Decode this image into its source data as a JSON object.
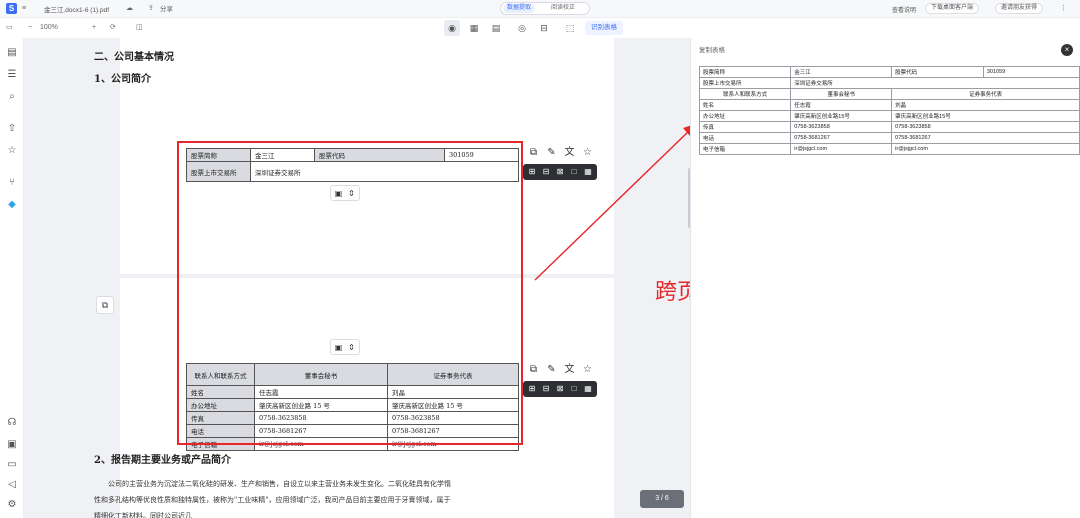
{
  "app": {
    "logo_glyph": "S"
  },
  "topbar": {
    "doc_name": "金三江.docx1-6 (1).pdf",
    "share_label": "分享",
    "modes": {
      "active": "数据提取",
      "inactive": "阅读校正"
    },
    "right": {
      "download_label": "下载桌面客户端",
      "invite_label": "邀请朋友获得"
    },
    "right_small": "查看说明"
  },
  "toolbar": {
    "zoom": "100%",
    "recognize_label": "识别表格"
  },
  "document": {
    "section_title": "二、公司基本情况",
    "sub_title": "1、公司简介",
    "stock_table": {
      "row1": [
        "股票简称",
        "金三江",
        "股票代码",
        "301059"
      ],
      "row2": [
        "股票上市交易所",
        "深圳证券交易所"
      ]
    },
    "contact_table": {
      "header": [
        "联系人和联系方式",
        "董事会秘书",
        "证券事务代表"
      ],
      "rows": [
        [
          "姓名",
          "任志霞",
          "刘晶"
        ],
        [
          "办公地址",
          "肇庆高新区创业路 15 号",
          "肇庆高新区创业路 15 号"
        ],
        [
          "传真",
          "0758-3623858",
          "0758-3623858"
        ],
        [
          "电话",
          "0758-3681267",
          "0758-3681267"
        ],
        [
          "电子信箱",
          "ir@jsjgcl.com",
          "ir@jsjgcl.com"
        ]
      ]
    },
    "section2_title": "2、报告期主要业务或产品简介",
    "paragraph": "公司的主营业务为沉淀法二氧化硅的研发、生产和销售，自设立以来主营业务未发生变化。二氧化硅具有化学惰性和多孔结构等优良性质和独特属性，被称为\"工业味精\"，应用领域广泛，我司产品目前主要应用于牙膏领域，属于精细化工新材料。同时公司近几",
    "page_indicator": "3 / 6"
  },
  "annotation": "跨页表格自动合并",
  "right_panel": {
    "title": "复制表格",
    "table": [
      [
        "股票简称",
        "金三江",
        "股票代码",
        "301059"
      ],
      [
        "股票上市交易所",
        "深圳证券交易所",
        "",
        ""
      ],
      [
        "联系人和联系方式",
        "董事会秘书",
        "证券事务代表",
        ""
      ],
      [
        "姓名",
        "任志霞",
        "刘晶",
        ""
      ],
      [
        "办公地址",
        "肇庆高新区创业路15号",
        "肇庆高新区创业路15号",
        ""
      ],
      [
        "传真",
        "0758-3623858",
        "0758-3623858",
        ""
      ],
      [
        "电话",
        "0758-3681267",
        "0758-3681267",
        ""
      ],
      [
        "电子信箱",
        "ir@jsjgcl.com",
        "ir@jsjgcl.com",
        ""
      ]
    ]
  },
  "colors": {
    "accent": "#3b6ef5",
    "highlight": "#e8262a"
  }
}
